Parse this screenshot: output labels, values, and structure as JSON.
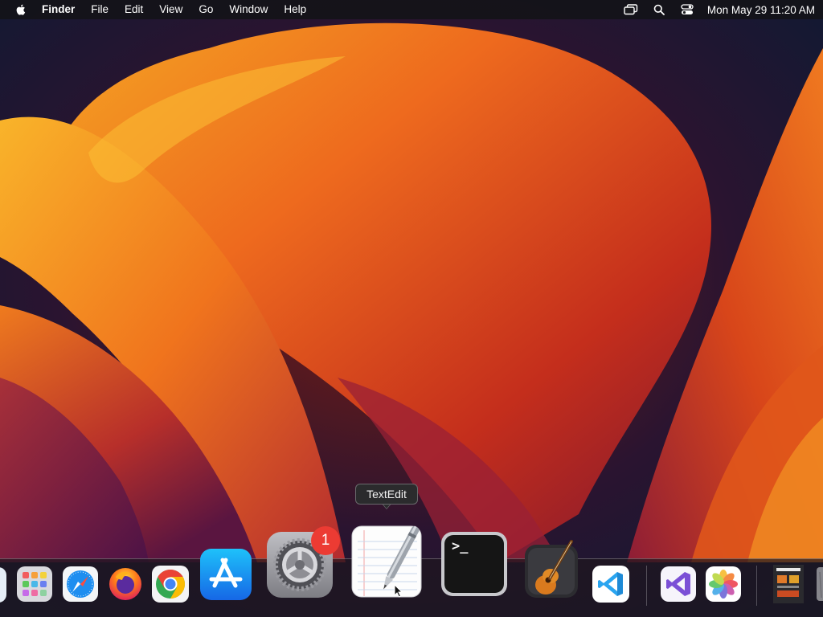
{
  "menubar": {
    "app_name": "Finder",
    "menus": [
      "File",
      "Edit",
      "View",
      "Go",
      "Window",
      "Help"
    ],
    "clock": "Mon May 29  11:20 AM",
    "status_icons": [
      "screen-mirroring-icon",
      "spotlight-search-icon",
      "control-center-icon"
    ]
  },
  "tooltip": {
    "label": "TextEdit"
  },
  "dock": {
    "apps": [
      {
        "name": "finder-partial",
        "icon": "finder-icon"
      },
      {
        "name": "launchpad",
        "icon": "launchpad-icon"
      },
      {
        "name": "safari",
        "icon": "safari-icon"
      },
      {
        "name": "firefox",
        "icon": "firefox-icon"
      },
      {
        "name": "chrome",
        "icon": "chrome-icon"
      },
      {
        "name": "app-store",
        "icon": "app-store-icon"
      },
      {
        "name": "system-preferences",
        "icon": "system-preferences-icon",
        "badge": "1"
      },
      {
        "name": "textedit",
        "icon": "textedit-icon"
      },
      {
        "name": "terminal",
        "icon": "terminal-icon",
        "prompt": ">_"
      },
      {
        "name": "garageband",
        "icon": "garageband-icon"
      },
      {
        "name": "vscode",
        "icon": "vscode-icon"
      },
      {
        "name": "visual-studio",
        "icon": "visual-studio-icon"
      },
      {
        "name": "photos",
        "icon": "photos-icon"
      },
      {
        "name": "document-thumbnail",
        "icon": "document-thumbnail-icon"
      },
      {
        "name": "trash-partial",
        "icon": "trash-icon"
      }
    ]
  },
  "colors": {
    "menubar_bg": "#141418",
    "badge": "#ec3b33",
    "wallpaper_orange": "#f39a1c",
    "wallpaper_red": "#c9361a",
    "wallpaper_navy": "#0c1a33"
  }
}
